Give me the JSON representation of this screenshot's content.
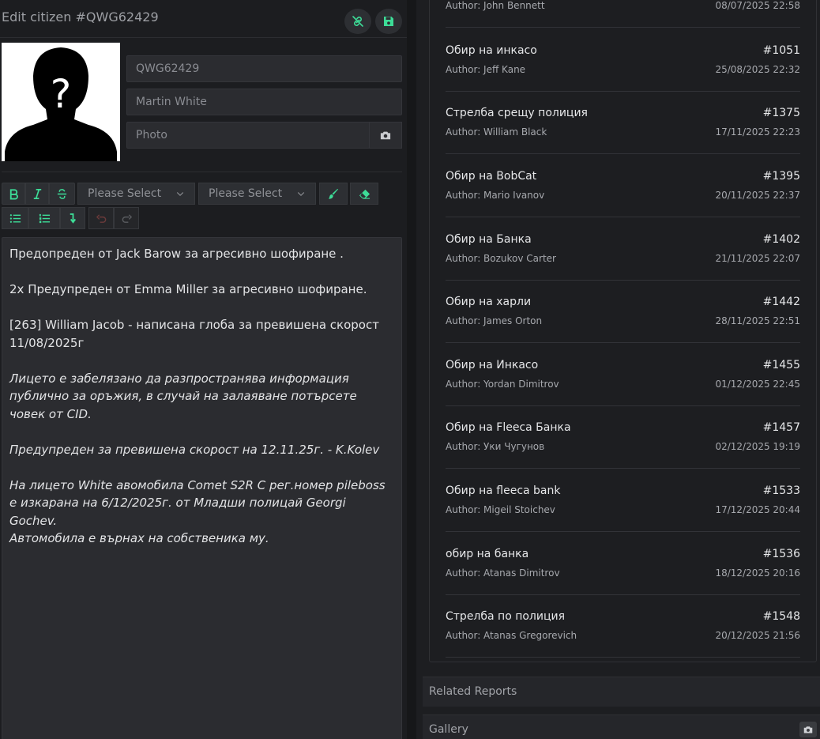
{
  "header": {
    "title": "Edit citizen #QWG62429",
    "unlink_icon": "unlink-icon",
    "save_icon": "save-icon",
    "accent_color": "#3ddc97"
  },
  "profile": {
    "citizen_id": "QWG62429",
    "name": "Martin  White",
    "photo_placeholder": "Photo",
    "photo_icon": "camera-icon"
  },
  "toolbar": {
    "bold_icon": "bold-icon",
    "italic_icon": "italic-icon",
    "strike_icon": "strikethrough-icon",
    "select1": "Please Select",
    "select2": "Please Select",
    "brush_icon": "brush-icon",
    "eraser_icon": "eraser-icon",
    "bullet_list_icon": "bullet-list-icon",
    "numbered_list_icon": "numbered-list-icon",
    "indent_icon": "indent-icon",
    "undo_icon": "undo-icon",
    "redo_icon": "redo-icon"
  },
  "notes": {
    "p1": "Предопреден от Jack Barow за агресивно шофиране .",
    "p2": "2x Предупреден от Emma Miller за агресивно шофиране.",
    "p3": "[263] William Jacob - написана глоба за превишена скорост 11/08/2025г",
    "p4": "Лицето е забелязано да разпространява информация публично за оръжия, в случай на залаяване потърсете човек от CID.",
    "p5": "Предупреден за превишена скорост на 12.11.25г. - K.Kolev",
    "p6a": "На лицето White авомобила Comet S2R C рег.номер pileboss е изкарана на 6/12/2025г. от Младши полицай Georgi Gochev.",
    "p6b": "Автомобила е върнах на собственика му."
  },
  "reports": [
    {
      "title": "",
      "number": "",
      "author": "Author: John Bennett",
      "date": "08/07/2025 22:58"
    },
    {
      "title": "Обир на инкасо",
      "number": "#1051",
      "author": "Author: Jeff Kane",
      "date": "25/08/2025 22:32"
    },
    {
      "title": "Стрелба срещу полиция",
      "number": "#1375",
      "author": "Author: William Black",
      "date": "17/11/2025 22:23"
    },
    {
      "title": "Обир на BobCat",
      "number": "#1395",
      "author": "Author: Mario Ivanov",
      "date": "20/11/2025 22:37"
    },
    {
      "title": "Обир на Банка",
      "number": "#1402",
      "author": "Author: Bozukov Carter",
      "date": "21/11/2025 22:07"
    },
    {
      "title": "Обир на харли",
      "number": "#1442",
      "author": "Author: James Orton",
      "date": "28/11/2025 22:51"
    },
    {
      "title": "Обир на Инкасо",
      "number": "#1455",
      "author": "Author: Yordan Dimitrov",
      "date": "01/12/2025 22:45"
    },
    {
      "title": "Обир на Fleeca Банка",
      "number": "#1457",
      "author": "Author: Уки Чугунов",
      "date": "02/12/2025 19:19"
    },
    {
      "title": "Обир на fleeca bank",
      "number": "#1533",
      "author": "Author: Migeil Stoichev",
      "date": "17/12/2025 20:44"
    },
    {
      "title": "обир на банка",
      "number": "#1536",
      "author": "Author: Atanas Dimitrov",
      "date": "18/12/2025 20:16"
    },
    {
      "title": "Стрелба по полиция",
      "number": "#1548",
      "author": "Author: Atanas Gregorevich",
      "date": "20/12/2025 21:56"
    }
  ],
  "sections": {
    "related_reports": "Related Reports",
    "gallery": "Gallery"
  }
}
